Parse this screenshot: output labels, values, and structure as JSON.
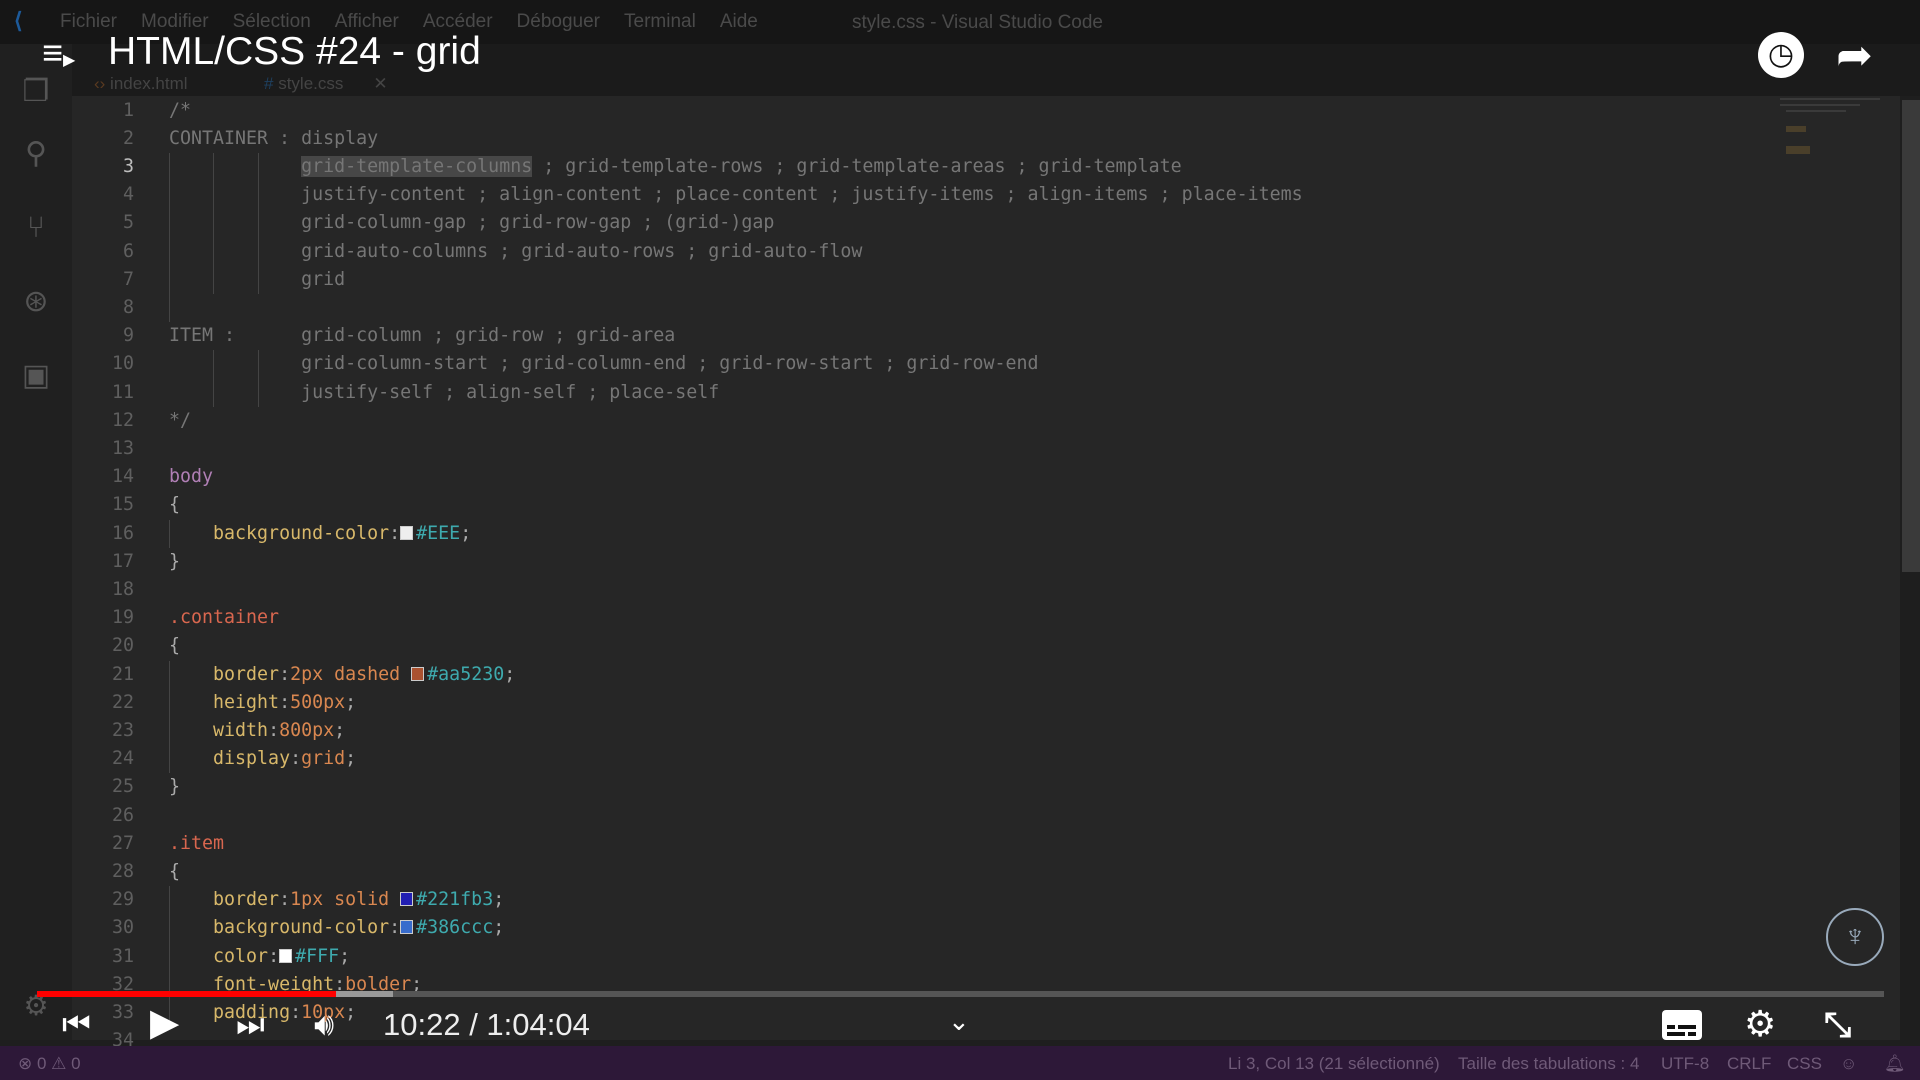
{
  "window": {
    "title": "style.css - Visual Studio Code",
    "menu": [
      "Fichier",
      "Modifier",
      "Sélection",
      "Afficher",
      "Accéder",
      "Déboguer",
      "Terminal",
      "Aide"
    ]
  },
  "tabs": [
    {
      "label": "index.html",
      "icon": "html-icon"
    },
    {
      "label": "style.css",
      "icon": "css-hash-icon",
      "active": true
    }
  ],
  "editor": {
    "current_line": 3,
    "lines": [
      [
        [
          "c",
          "/*"
        ]
      ],
      [
        [
          "c",
          "CONTAINER : display"
        ]
      ],
      [
        [
          "c",
          "      "
        ],
        [
          "sel",
          "grid-template-columns"
        ],
        [
          "c",
          " ; grid-template-rows ; grid-template-areas ; grid-template"
        ]
      ],
      [
        [
          "c",
          "      justify-content ; align-content ; place-content ; justify-items ; align-items ; place-items"
        ]
      ],
      [
        [
          "c",
          "      grid-column-gap ; grid-row-gap ; (grid-)gap"
        ]
      ],
      [
        [
          "c",
          "      grid-auto-columns ; grid-auto-rows ; grid-auto-flow"
        ]
      ],
      [
        [
          "c",
          "      grid"
        ]
      ],
      [],
      [
        [
          "c",
          "ITEM :      grid-column ; grid-row ; grid-area"
        ]
      ],
      [
        [
          "c",
          "      grid-column-start ; grid-column-end ; grid-row-start ; grid-row-end"
        ]
      ],
      [
        [
          "c",
          "      justify-self ; align-self ; place-self"
        ]
      ],
      [
        [
          "c",
          "*/"
        ]
      ],
      [],
      [
        [
          "s",
          "body"
        ]
      ],
      [
        [
          "x",
          "{"
        ]
      ],
      [
        [
          "x",
          "  "
        ],
        [
          "p",
          "background-color"
        ],
        [
          "x",
          ":"
        ],
        [
          "sw",
          "#EEEEEE"
        ],
        [
          "h",
          "#EEE"
        ],
        [
          "x",
          ";"
        ]
      ],
      [
        [
          "x",
          "}"
        ]
      ],
      [],
      [
        [
          "cl",
          ".container"
        ]
      ],
      [
        [
          "x",
          "{"
        ]
      ],
      [
        [
          "x",
          "  "
        ],
        [
          "p",
          "border"
        ],
        [
          "x",
          ":"
        ],
        [
          "v",
          "2px dashed "
        ],
        [
          "sw",
          "#aa5230"
        ],
        [
          "h",
          "#aa5230"
        ],
        [
          "x",
          ";"
        ]
      ],
      [
        [
          "x",
          "  "
        ],
        [
          "p",
          "height"
        ],
        [
          "x",
          ":"
        ],
        [
          "v",
          "500px"
        ],
        [
          "x",
          ";"
        ]
      ],
      [
        [
          "x",
          "  "
        ],
        [
          "p",
          "width"
        ],
        [
          "x",
          ":"
        ],
        [
          "v",
          "800px"
        ],
        [
          "x",
          ";"
        ]
      ],
      [
        [
          "x",
          "  "
        ],
        [
          "p",
          "display"
        ],
        [
          "x",
          ":"
        ],
        [
          "v",
          "grid"
        ],
        [
          "x",
          ";"
        ]
      ],
      [
        [
          "x",
          "}"
        ]
      ],
      [],
      [
        [
          "cl",
          ".item"
        ]
      ],
      [
        [
          "x",
          "{"
        ]
      ],
      [
        [
          "x",
          "  "
        ],
        [
          "p",
          "border"
        ],
        [
          "x",
          ":"
        ],
        [
          "v",
          "1px solid "
        ],
        [
          "sw",
          "#221fb3"
        ],
        [
          "h",
          "#221fb3"
        ],
        [
          "x",
          ";"
        ]
      ],
      [
        [
          "x",
          "  "
        ],
        [
          "p",
          "background-color"
        ],
        [
          "x",
          ":"
        ],
        [
          "sw",
          "#386ccc"
        ],
        [
          "h",
          "#386ccc"
        ],
        [
          "x",
          ";"
        ]
      ],
      [
        [
          "x",
          "  "
        ],
        [
          "p",
          "color"
        ],
        [
          "x",
          ":"
        ],
        [
          "sw",
          "#FFFFFF"
        ],
        [
          "h",
          "#FFF"
        ],
        [
          "x",
          ";"
        ]
      ],
      [
        [
          "x",
          "  "
        ],
        [
          "p",
          "font-weight"
        ],
        [
          "x",
          ":"
        ],
        [
          "v",
          "bolder"
        ],
        [
          "x",
          ";"
        ]
      ],
      [
        [
          "x",
          "  "
        ],
        [
          "p",
          "padding"
        ],
        [
          "x",
          ":"
        ],
        [
          "v",
          "10px"
        ],
        [
          "x",
          ";"
        ]
      ],
      []
    ]
  },
  "statusbar": {
    "errors": "0",
    "warnings": "0",
    "position": "Li 3, Col 13 (21 sélectionné)",
    "tab_size": "Taille des tabulations : 4",
    "encoding": "UTF-8",
    "eol": "CRLF",
    "language": "CSS"
  },
  "video": {
    "title": "HTML/CSS #24 - grid",
    "time": "10:22 / 1:04:04",
    "played_percent": 16.2,
    "buffered_percent": 19.3,
    "accent": "#ff0000"
  }
}
